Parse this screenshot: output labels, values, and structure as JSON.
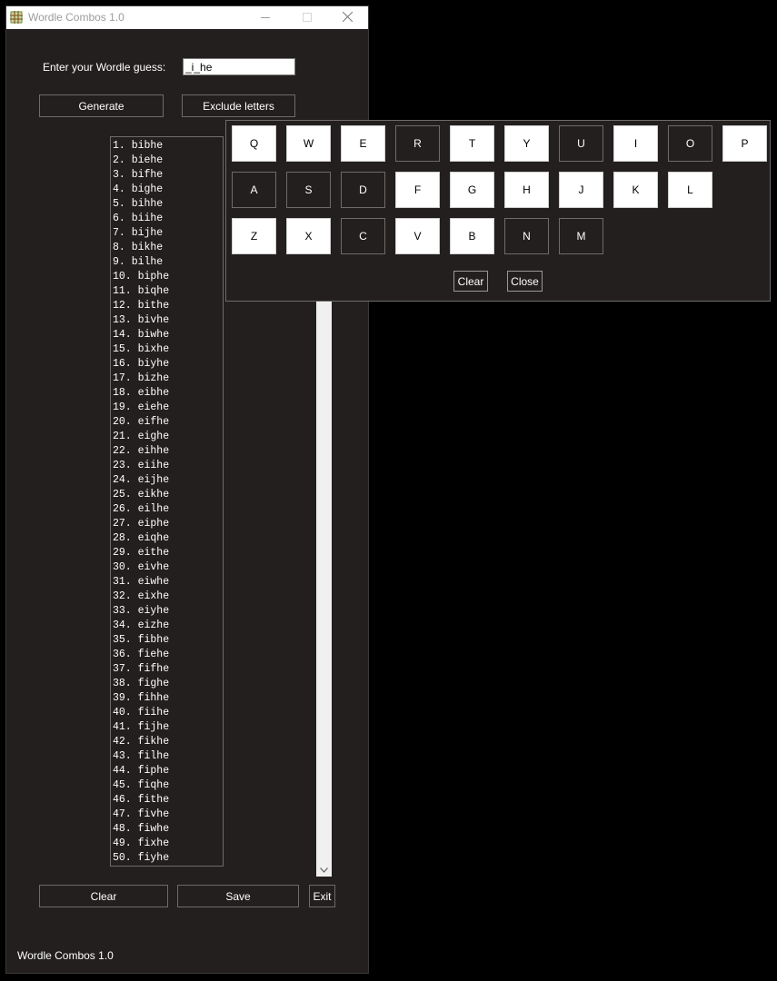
{
  "window": {
    "title": "Wordle Combos 1.0",
    "footer": "Wordle Combos 1.0"
  },
  "form": {
    "guess_label": "Enter your Wordle guess:",
    "guess_value": "_i_he",
    "generate_label": "Generate",
    "exclude_label": "Exclude letters"
  },
  "results": [
    "1. bibhe",
    "2. biehe",
    "3. bifhe",
    "4. bighe",
    "5. bihhe",
    "6. biihe",
    "7. bijhe",
    "8. bikhe",
    "9. bilhe",
    "10. biphe",
    "11. biqhe",
    "12. bithe",
    "13. bivhe",
    "14. biwhe",
    "15. bixhe",
    "16. biyhe",
    "17. bizhe",
    "18. eibhe",
    "19. eiehe",
    "20. eifhe",
    "21. eighe",
    "22. eihhe",
    "23. eiihe",
    "24. eijhe",
    "25. eikhe",
    "26. eilhe",
    "27. eiphe",
    "28. eiqhe",
    "29. eithe",
    "30. eivhe",
    "31. eiwhe",
    "32. eixhe",
    "33. eiyhe",
    "34. eizhe",
    "35. fibhe",
    "36. fiehe",
    "37. fifhe",
    "38. fighe",
    "39. fihhe",
    "40. fiihe",
    "41. fijhe",
    "42. fikhe",
    "43. filhe",
    "44. fiphe",
    "45. fiqhe",
    "46. fithe",
    "47. fivhe",
    "48. fiwhe",
    "49. fixhe",
    "50. fiyhe"
  ],
  "buttons": {
    "clear_label": "Clear",
    "save_label": "Save",
    "exit_label": "Exit"
  },
  "keyboard": {
    "rows": [
      [
        {
          "letter": "Q",
          "excluded": false
        },
        {
          "letter": "W",
          "excluded": false
        },
        {
          "letter": "E",
          "excluded": false
        },
        {
          "letter": "R",
          "excluded": true
        },
        {
          "letter": "T",
          "excluded": false
        },
        {
          "letter": "Y",
          "excluded": false
        },
        {
          "letter": "U",
          "excluded": true
        },
        {
          "letter": "I",
          "excluded": false
        },
        {
          "letter": "O",
          "excluded": true
        },
        {
          "letter": "P",
          "excluded": false
        }
      ],
      [
        {
          "letter": "A",
          "excluded": true
        },
        {
          "letter": "S",
          "excluded": true
        },
        {
          "letter": "D",
          "excluded": true
        },
        {
          "letter": "F",
          "excluded": false
        },
        {
          "letter": "G",
          "excluded": false
        },
        {
          "letter": "H",
          "excluded": false
        },
        {
          "letter": "J",
          "excluded": false
        },
        {
          "letter": "K",
          "excluded": false
        },
        {
          "letter": "L",
          "excluded": false
        }
      ],
      [
        {
          "letter": "Z",
          "excluded": false
        },
        {
          "letter": "X",
          "excluded": false
        },
        {
          "letter": "C",
          "excluded": true
        },
        {
          "letter": "V",
          "excluded": false
        },
        {
          "letter": "B",
          "excluded": false
        },
        {
          "letter": "N",
          "excluded": true
        },
        {
          "letter": "M",
          "excluded": true
        }
      ]
    ],
    "clear_label": "Clear",
    "close_label": "Close"
  },
  "colors": {
    "window_bg": "#231f1e",
    "key_active_bg": "#ffffff",
    "key_excluded_bg": "#231f1e"
  },
  "icons": [
    "app-icon",
    "minimize-icon",
    "maximize-icon",
    "close-icon",
    "scroll-down-arrow-icon"
  ]
}
